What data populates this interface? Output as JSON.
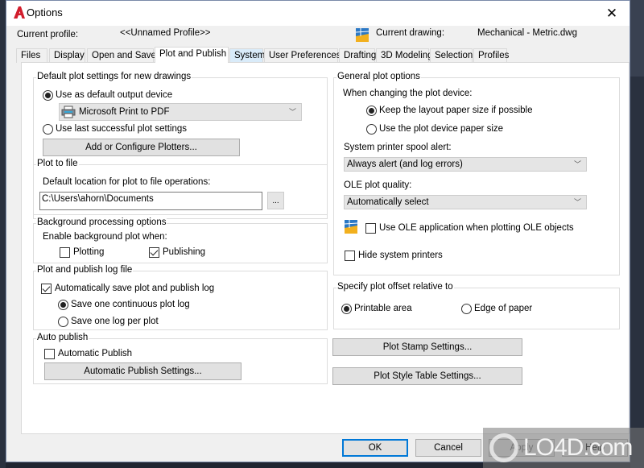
{
  "window": {
    "title": "Options",
    "close_glyph": "✕"
  },
  "profile": {
    "current_profile_label": "Current profile:",
    "current_profile_value": "<<Unnamed Profile>>",
    "current_drawing_label": "Current drawing:",
    "current_drawing_value": "Mechanical - Metric.dwg"
  },
  "tabs": [
    {
      "label": "Files"
    },
    {
      "label": "Display"
    },
    {
      "label": "Open and Save"
    },
    {
      "label": "Plot and Publish",
      "active": true
    },
    {
      "label": "System"
    },
    {
      "label": "User Preferences"
    },
    {
      "label": "Drafting"
    },
    {
      "label": "3D Modeling"
    },
    {
      "label": "Selection"
    },
    {
      "label": "Profiles"
    }
  ],
  "default_plot": {
    "title": "Default plot settings for new drawings",
    "use_default_device": "Use as default output device",
    "use_default_selected": true,
    "device_value": "Microsoft Print to PDF",
    "use_last_settings": "Use last successful plot settings",
    "use_last_selected": false,
    "add_configure_button": "Add or Configure Plotters..."
  },
  "plot_to_file": {
    "title": "Plot to file",
    "location_label": "Default location for plot to file operations:",
    "location_value": "C:\\Users\\ahorn\\Documents",
    "browse_button": "..."
  },
  "background": {
    "title": "Background processing options",
    "enable_label": "Enable background plot when:",
    "plotting_label": "Plotting",
    "plotting_checked": false,
    "publishing_label": "Publishing",
    "publishing_checked": true
  },
  "log_file": {
    "title": "Plot and publish log file",
    "auto_save_label": "Automatically save plot and publish log",
    "auto_save_checked": true,
    "continuous_label": "Save one continuous plot log",
    "continuous_selected": true,
    "per_plot_label": "Save one log per plot",
    "per_plot_selected": false
  },
  "auto_publish": {
    "title": "Auto publish",
    "checkbox_label": "Automatic Publish",
    "checked": false,
    "settings_button": "Automatic Publish Settings..."
  },
  "general": {
    "title": "General plot options",
    "changing_label": "When changing the plot device:",
    "keep_layout_label": "Keep the layout paper size if possible",
    "keep_layout_selected": true,
    "use_device_label": "Use the plot device paper size",
    "use_device_selected": false,
    "spool_label": "System printer spool alert:",
    "spool_value": "Always alert (and log errors)",
    "ole_quality_label": "OLE plot quality:",
    "ole_quality_value": "Automatically select",
    "use_ole_label": "Use OLE application when plotting OLE objects",
    "use_ole_checked": false,
    "hide_printers_label": "Hide system printers",
    "hide_printers_checked": false
  },
  "offset": {
    "title": "Specify plot offset relative to",
    "printable_label": "Printable area",
    "printable_selected": true,
    "edge_label": "Edge of paper",
    "edge_selected": false
  },
  "buttons": {
    "plot_stamp": "Plot Stamp Settings...",
    "plot_style_table": "Plot Style Table Settings...",
    "ok": "OK",
    "cancel": "Cancel",
    "apply": "Apply",
    "help": "Help"
  },
  "watermark": {
    "text": "LO4D.com"
  }
}
